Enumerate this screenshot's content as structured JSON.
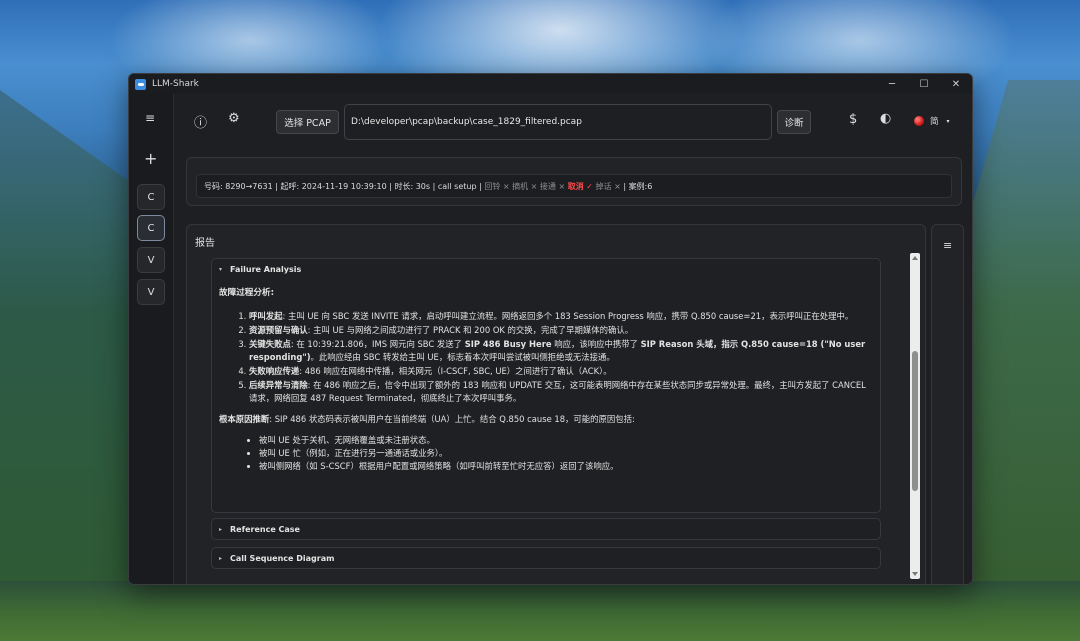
{
  "window": {
    "title": "LLM-Shark"
  },
  "window_controls": {
    "minimize": "─",
    "maximize": "☐",
    "close": "✕"
  },
  "sidebar": {
    "menu_icon": "≡",
    "add_icon": "+",
    "items": [
      {
        "label": "C"
      },
      {
        "label": "C"
      },
      {
        "label": "V"
      },
      {
        "label": "V"
      }
    ]
  },
  "toolbar": {
    "info_icon": "ⓘ",
    "settings_icon": "⚙",
    "select_pcap_label": "选择 PCAP",
    "pcap_path": "D:\\developer\\pcap\\backup\\case_1829_filtered.pcap",
    "diagnose_label": "诊断",
    "dollar_icon": "$",
    "theme_icon": "◐",
    "language_label": "简",
    "language_caret": "▾"
  },
  "info": {
    "number": "号码: 8290→7631",
    "start": "起呼: 2024-11-19 10:39:10",
    "duration": "时长: 30s",
    "type": "call setup",
    "ringback": "回铃",
    "answer": "摘机",
    "connect": "接通",
    "cancel": "取消",
    "drop": "掉话",
    "case": "案例:6",
    "x_mark": "×",
    "check_mark": "✓",
    "sep": "|"
  },
  "report": {
    "title": "报告",
    "right_menu_icon": "≡",
    "sections": [
      {
        "title": "Failure Analysis",
        "expanded": true
      },
      {
        "title": "Reference Case",
        "expanded": false
      },
      {
        "title": "Call Sequence Diagram",
        "expanded": false
      }
    ],
    "expanded_caret": "▾",
    "collapsed_caret": "▸",
    "analysis": {
      "heading": "故障过程分析:",
      "steps": [
        {
          "title": "呼叫发起",
          "text": ": 主叫 UE 向 SBC 发送 INVITE 请求，启动呼叫建立流程。网络返回多个 183 Session Progress 响应，携带 Q.850 cause=21，表示呼叫正在处理中。"
        },
        {
          "title": "资源预留与确认",
          "text": ": 主叫 UE 与网络之间成功进行了 PRACK 和 200 OK 的交换，完成了早期媒体的确认。"
        },
        {
          "title": "关键失败点",
          "text_1": ": 在 10:39:21.806，IMS 网元向 SBC 发送了 ",
          "bold_1": "SIP 486 Busy Here",
          "text_2": " 响应，该响应中携带了 ",
          "bold_2": "SIP Reason 头域，指示 Q.850 cause=18 (\"No user responding\")",
          "text_3": "。此响应经由 SBC 转发给主叫 UE，标志着本次呼叫尝试被叫侧拒绝或无法接通。"
        },
        {
          "title": "失败响应传递",
          "text": ": 486 响应在网络中传播，相关网元（I-CSCF, SBC, UE）之间进行了确认（ACK）。"
        },
        {
          "title": "后续异常与清除",
          "text": ": 在 486 响应之后，信令中出现了额外的 183 响应和 UPDATE 交互，这可能表明网络中存在某些状态同步或异常处理。最终，主叫方发起了 CANCEL 请求，网络回复 487 Request Terminated，彻底终止了本次呼叫事务。"
        }
      ],
      "root_title": "根本原因推断",
      "root_text": ": SIP 486 状态码表示被叫用户在当前终端（UA）上忙。结合 Q.850 cause 18，可能的原因包括:",
      "causes": [
        "被叫 UE 处于关机、无网络覆盖或未注册状态。",
        "被叫 UE 忙（例如，正在进行另一通通话或业务）。",
        "被叫侧网络（如 S-CSCF）根据用户配置或网络策略（如呼叫前转至忙时无应答）返回了该响应。"
      ]
    }
  }
}
